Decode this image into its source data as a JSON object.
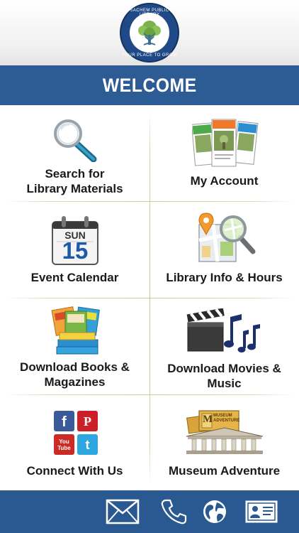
{
  "header": {
    "logo_name": "SACHEM PUBLIC LIBRARY",
    "logo_tagline": "YOUR PLACE TO GROW"
  },
  "welcome": {
    "title": "WELCOME"
  },
  "tiles": [
    {
      "label_line1": "Search for",
      "label_line2": "Library Materials",
      "icon": "magnifier-icon"
    },
    {
      "label_line1": "My Account",
      "label_line2": "",
      "icon": "library-cards-icon"
    },
    {
      "label_line1": "Event Calendar",
      "label_line2": "",
      "icon": "calendar-icon",
      "calendar_day": "SUN",
      "calendar_date": "15"
    },
    {
      "label_line1": "Library Info & Hours",
      "label_line2": "",
      "icon": "map-search-icon"
    },
    {
      "label_line1": "Download Books &",
      "label_line2": "Magazines",
      "icon": "books-magazines-icon"
    },
    {
      "label_line1": "Download Movies &",
      "label_line2": "Music",
      "icon": "clapper-music-icon"
    },
    {
      "label_line1": "Connect With Us",
      "label_line2": "",
      "icon": "social-icons",
      "social": {
        "facebook": "f",
        "pinterest": "P",
        "youtube": "You Tube",
        "twitter": "t"
      }
    },
    {
      "label_line1": "Museum Adventure",
      "label_line2": "",
      "icon": "museum-icon",
      "ticket_text": "MUSEUM ADVENTURE"
    }
  ],
  "footer": {
    "buttons": [
      "email-icon",
      "phone-icon",
      "globe-icon",
      "contact-card-icon"
    ]
  },
  "colors": {
    "brand_blue": "#2d5b94",
    "footer_blue": "#2a5891",
    "divider_green": "#bcd19a"
  }
}
